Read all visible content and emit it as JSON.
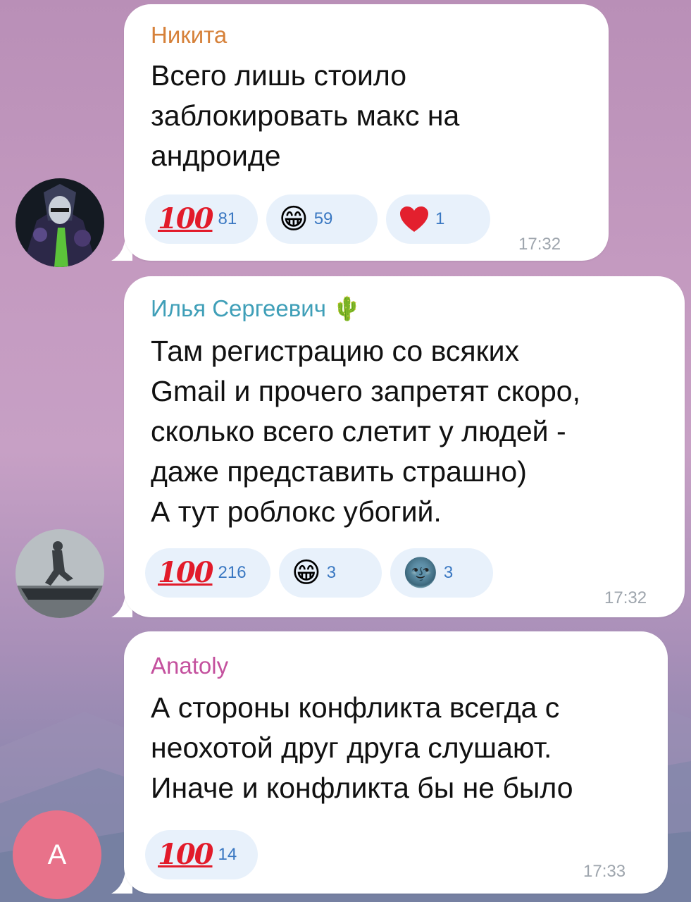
{
  "messages": [
    {
      "sender": "Никита",
      "sender_color": "#d6813a",
      "text": "Всего лишь стоило\nзаблокировать макс на\nандроиде",
      "time": "17:32",
      "reactions": [
        {
          "emoji": "100",
          "count": "81"
        },
        {
          "emoji": "😁",
          "count": "59"
        },
        {
          "emoji": "❤️",
          "count": "1"
        }
      ],
      "avatar_icon": "dark-knight-avatar-icon"
    },
    {
      "sender": "Илья Сергеевич",
      "sender_emoji": "🌵",
      "sender_color": "#3f9fb8",
      "text": "Там регистрацию со всяких\nGmail и прочего запретят скоро,\nсколько всего слетит у людей -\nдаже представить страшно)\nА тут роблокс убогий.",
      "time": "17:32",
      "reactions": [
        {
          "emoji": "100",
          "count": "216"
        },
        {
          "emoji": "😁",
          "count": "3"
        },
        {
          "emoji": "🌚",
          "count": "3"
        }
      ],
      "avatar_icon": "soldier-on-boat-avatar-icon"
    },
    {
      "sender": "Anatoly",
      "sender_color": "#c4519e",
      "text": "А стороны конфликта всегда с\nнеохотой друг друга слушают.\nИначе и конфликта бы не было",
      "time": "17:33",
      "reactions": [
        {
          "emoji": "100",
          "count": "14"
        }
      ],
      "avatar_letter": "A",
      "avatar_color": "#e8728a"
    }
  ]
}
